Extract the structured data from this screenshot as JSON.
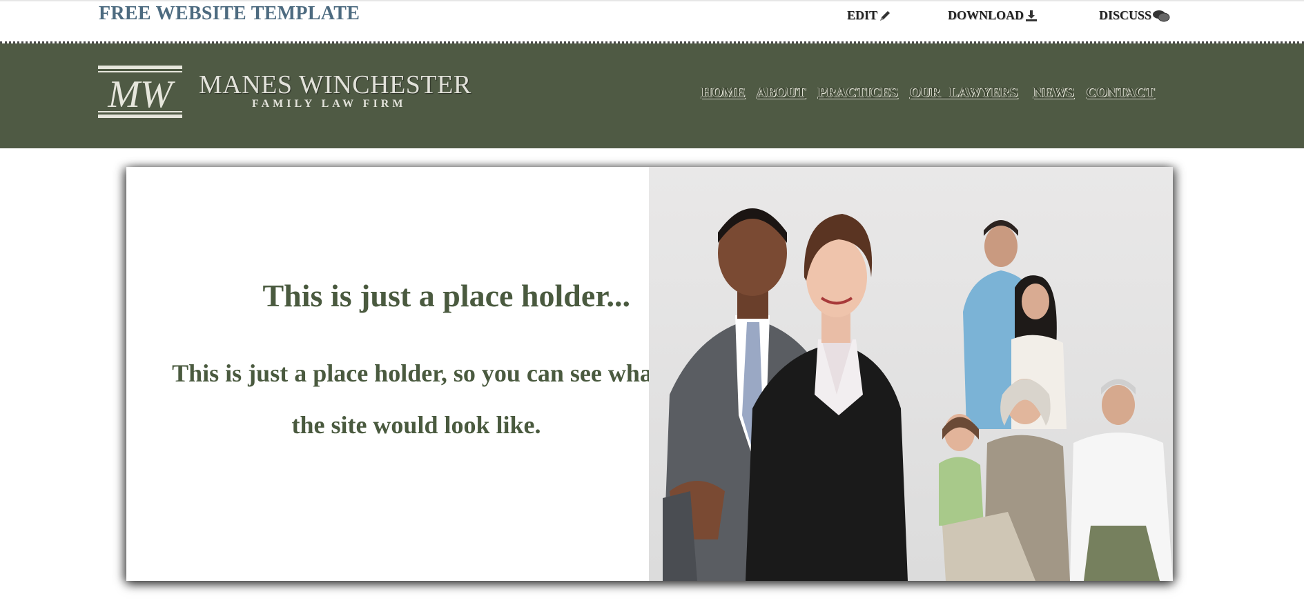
{
  "topbar": {
    "title": "FREE WEBSITE TEMPLATE",
    "links": {
      "edit": "EDIT",
      "download": "DOWNLOAD",
      "discuss": "DISCUSS"
    }
  },
  "header": {
    "logo_monogram": "MW",
    "firm_name": "MANES WINCHESTER",
    "firm_tagline": "FAMILY LAW FIRM",
    "nav": [
      "HOME",
      "ABOUT",
      "PRACTICES",
      "OUR LAWYERS",
      "NEWS",
      "CONTACT"
    ]
  },
  "hero": {
    "heading": "This is just a place holder...",
    "body": "This is just a place holder, so you can see what the site would look like."
  },
  "colors": {
    "header_bg": "#4f5a44",
    "title_blue": "#4d6b80",
    "hero_text": "#4a5a3f"
  }
}
